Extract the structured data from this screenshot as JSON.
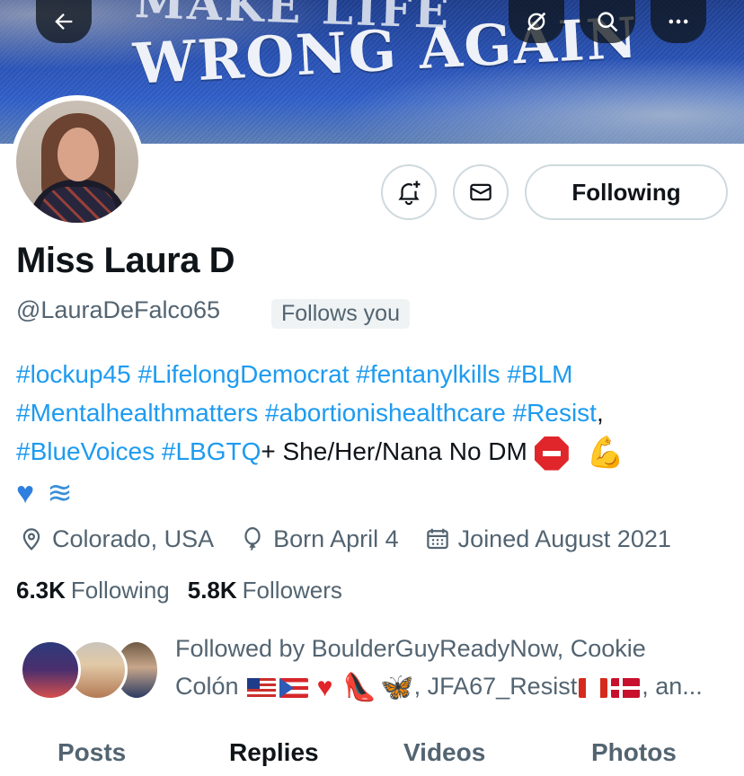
{
  "banner": {
    "text_top": "MAKE LIFE",
    "text_main": "WRONG AGAIN"
  },
  "nav": {
    "back_icon": "arrow-left-icon",
    "grok_icon": "grok-icon",
    "search_icon": "search-icon",
    "more_icon": "more-icon"
  },
  "profile": {
    "display_name": "Miss Laura D",
    "handle": "@LauraDeFalco65",
    "follows_you": "Follows you",
    "following_button": "Following",
    "bio": {
      "line1": [
        "#lockup45",
        "#LifelongDemocrat",
        "#fentanylkills",
        "#BLM"
      ],
      "line2": [
        "#Mentalhealthmatters",
        "#abortionishealthcare",
        "#Resist"
      ],
      "line2_suffix": ",",
      "line3_tags": [
        "#BlueVoices",
        "#LBGTQ"
      ],
      "line3_text": "+ She/Her/Nana No DM",
      "emojis": [
        "stop-sign",
        "flexed-biceps",
        "blue-heart",
        "water-wave"
      ]
    },
    "location": "Colorado, USA",
    "birthday": "Born April 4",
    "joined": "Joined August 2021",
    "following_count": "6.3K",
    "following_label": "Following",
    "followers_count": "5.8K",
    "followers_label": "Followers",
    "followed_by": {
      "prefix": "Followed by BoulderGuyReadyNow, Cookie",
      "line2_name": "Colón",
      "line2_mid": ", JFA67_Resist",
      "line2_end": ", an..."
    }
  },
  "tabs": [
    {
      "label": "Posts",
      "active": false
    },
    {
      "label": "Replies",
      "active": true
    },
    {
      "label": "Videos",
      "active": false
    },
    {
      "label": "Photos",
      "active": false
    }
  ],
  "colors": {
    "link": "#1d9bf0",
    "secondary_text": "#536471",
    "primary_text": "#0f1419",
    "border": "#cfd9de"
  }
}
